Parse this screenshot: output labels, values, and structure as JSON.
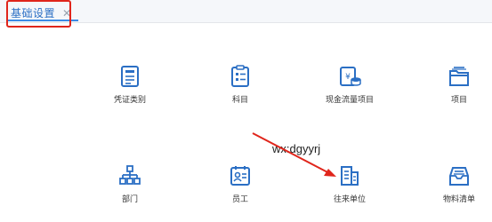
{
  "tabs": [
    {
      "label": "基础设置",
      "active": true,
      "close_icon": "close-icon"
    }
  ],
  "tiles": [
    {
      "label": "凭证类别",
      "icon": "voucher-icon"
    },
    {
      "label": "科目",
      "icon": "clipboard-list-icon"
    },
    {
      "label": "现金流量项目",
      "icon": "cash-flow-icon"
    },
    {
      "label": "项目",
      "icon": "folder-icon"
    },
    {
      "label": "部门",
      "icon": "org-chart-icon"
    },
    {
      "label": "员工",
      "icon": "employee-card-icon"
    },
    {
      "label": "往来单位",
      "icon": "building-icon"
    },
    {
      "label": "物料清单",
      "icon": "inbox-tray-icon"
    }
  ],
  "watermark": "wx:dgyyrj",
  "colors": {
    "accent": "#3b8be6",
    "icon_blue": "#2b6fc4",
    "annotation_red": "#e0251b"
  }
}
